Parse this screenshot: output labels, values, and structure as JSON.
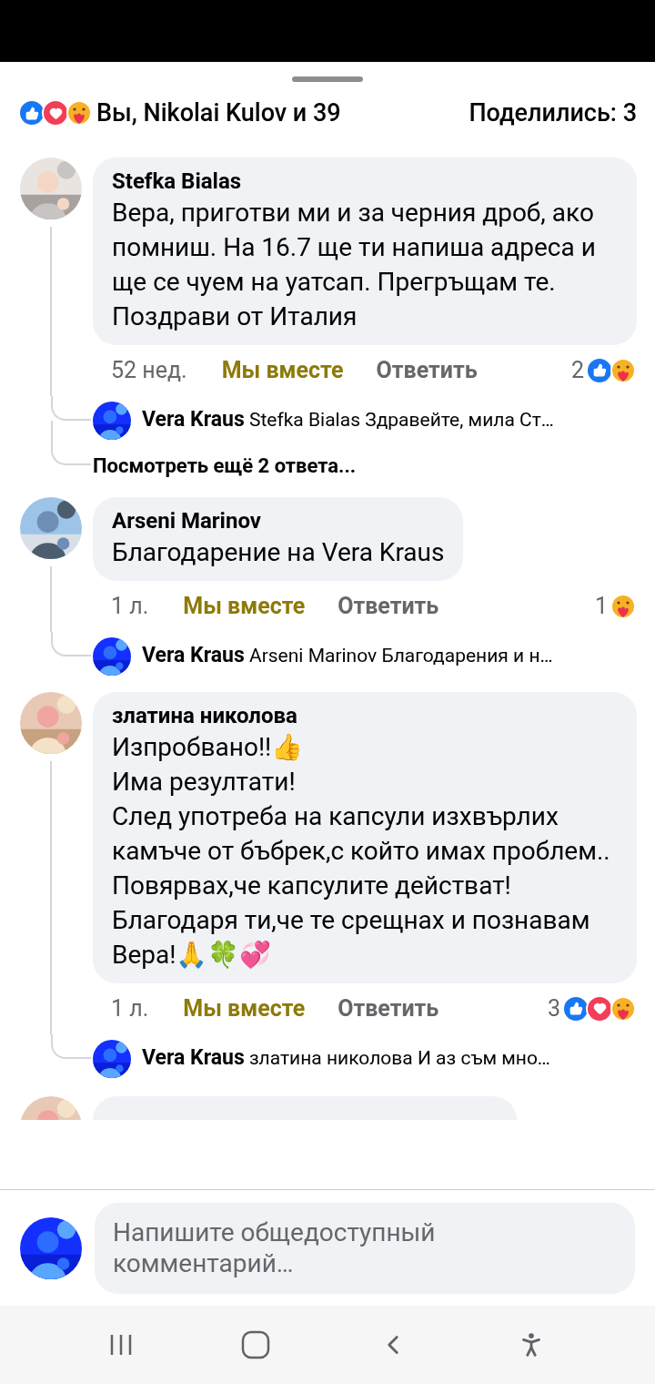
{
  "summary": {
    "reactions": [
      {
        "kind": "like"
      },
      {
        "kind": "love"
      },
      {
        "kind": "care"
      }
    ],
    "text": "Вы, Nikolai Kulov и 39",
    "shares": "Поделились: 3"
  },
  "comments": [
    {
      "author": "Stefka Bialas",
      "text": "Вера,  приготви ми и за черния дроб, ако помниш. На 16.7 ще ти напиша адреса и ще се чуем на уатсап. Прегръщам те. Поздрави от Италия",
      "time": "52 нед.",
      "react_label": "Мы вместе",
      "reacted": true,
      "reply_label": "Ответить",
      "reaction_count": "2",
      "reactions": [
        {
          "kind": "like"
        },
        {
          "kind": "care"
        }
      ],
      "replies": [
        {
          "kind": "reply",
          "author": "Vera Kraus",
          "text": "Stefka Bialas Здравейте, мила Ст…"
        },
        {
          "kind": "more",
          "text": "Посмотреть ещё 2 ответа..."
        }
      ]
    },
    {
      "author": "Arseni Marinov",
      "text": "Благодарение на Vera Kraus",
      "time": "1 л.",
      "react_label": "Мы вместе",
      "reacted": true,
      "reply_label": "Ответить",
      "reaction_count": "1",
      "reactions": [
        {
          "kind": "care"
        }
      ],
      "replies": [
        {
          "kind": "reply",
          "author": "Vera Kraus",
          "text": "Arseni Marinov Благодарения и н…"
        }
      ]
    },
    {
      "author": "златина николова",
      "text": "Изпробвано!!👍\nИма резултати!\nСлед употреба на капсули изхвърлих камъче от бъбрек,с който имах проблем..\nПовярвах,че капсулите действат!\nБлагодаря ти,че те срещнах и познавам Вера!🙏🍀💞",
      "time": "1 л.",
      "react_label": "Мы вместе",
      "reacted": true,
      "reply_label": "Ответить",
      "reaction_count": "3",
      "reactions": [
        {
          "kind": "like"
        },
        {
          "kind": "love"
        },
        {
          "kind": "care"
        }
      ],
      "replies": [
        {
          "kind": "reply",
          "author": "Vera Kraus",
          "text": "златина николова И аз съм мно…"
        }
      ]
    }
  ],
  "composer": {
    "placeholder": "Напишите общедоступный комментарий…"
  }
}
